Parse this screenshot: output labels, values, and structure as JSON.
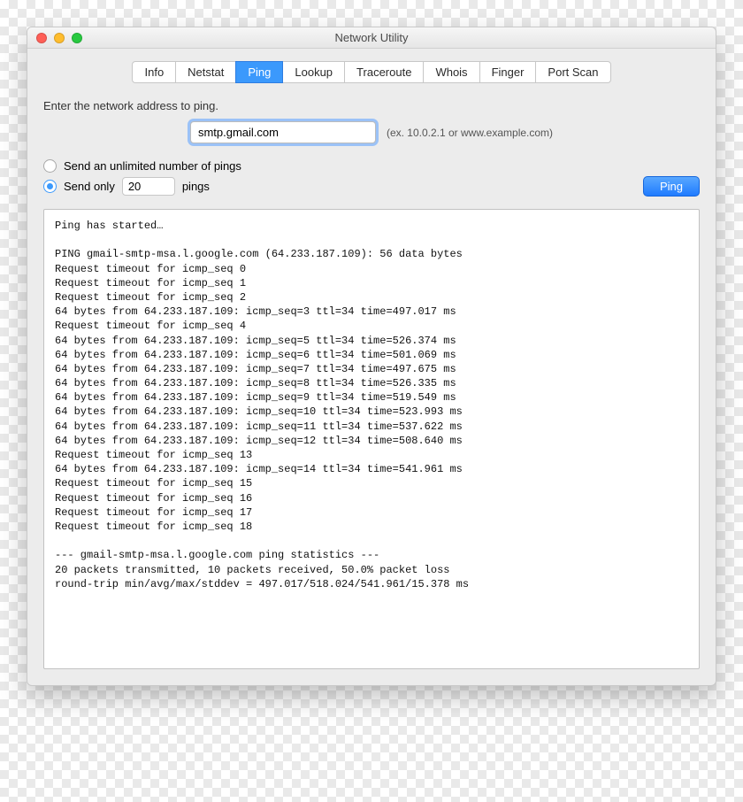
{
  "window": {
    "title": "Network Utility"
  },
  "tabs": {
    "items": [
      {
        "label": "Info"
      },
      {
        "label": "Netstat"
      },
      {
        "label": "Ping"
      },
      {
        "label": "Lookup"
      },
      {
        "label": "Traceroute"
      },
      {
        "label": "Whois"
      },
      {
        "label": "Finger"
      },
      {
        "label": "Port Scan"
      }
    ],
    "active_index": 2
  },
  "form": {
    "prompt": "Enter the network address to ping.",
    "address_value": "smtp.gmail.com",
    "address_hint": "(ex. 10.0.2.1 or www.example.com)",
    "unlimited_label": "Send an unlimited number of pings",
    "send_only_prefix": "Send only",
    "send_only_suffix": "pings",
    "count_value": "20",
    "selected_option": "send_only",
    "ping_button": "Ping"
  },
  "output_text": "Ping has started…\n\nPING gmail-smtp-msa.l.google.com (64.233.187.109): 56 data bytes\nRequest timeout for icmp_seq 0\nRequest timeout for icmp_seq 1\nRequest timeout for icmp_seq 2\n64 bytes from 64.233.187.109: icmp_seq=3 ttl=34 time=497.017 ms\nRequest timeout for icmp_seq 4\n64 bytes from 64.233.187.109: icmp_seq=5 ttl=34 time=526.374 ms\n64 bytes from 64.233.187.109: icmp_seq=6 ttl=34 time=501.069 ms\n64 bytes from 64.233.187.109: icmp_seq=7 ttl=34 time=497.675 ms\n64 bytes from 64.233.187.109: icmp_seq=8 ttl=34 time=526.335 ms\n64 bytes from 64.233.187.109: icmp_seq=9 ttl=34 time=519.549 ms\n64 bytes from 64.233.187.109: icmp_seq=10 ttl=34 time=523.993 ms\n64 bytes from 64.233.187.109: icmp_seq=11 ttl=34 time=537.622 ms\n64 bytes from 64.233.187.109: icmp_seq=12 ttl=34 time=508.640 ms\nRequest timeout for icmp_seq 13\n64 bytes from 64.233.187.109: icmp_seq=14 ttl=34 time=541.961 ms\nRequest timeout for icmp_seq 15\nRequest timeout for icmp_seq 16\nRequest timeout for icmp_seq 17\nRequest timeout for icmp_seq 18\n\n--- gmail-smtp-msa.l.google.com ping statistics ---\n20 packets transmitted, 10 packets received, 50.0% packet loss\nround-trip min/avg/max/stddev = 497.017/518.024/541.961/15.378 ms"
}
